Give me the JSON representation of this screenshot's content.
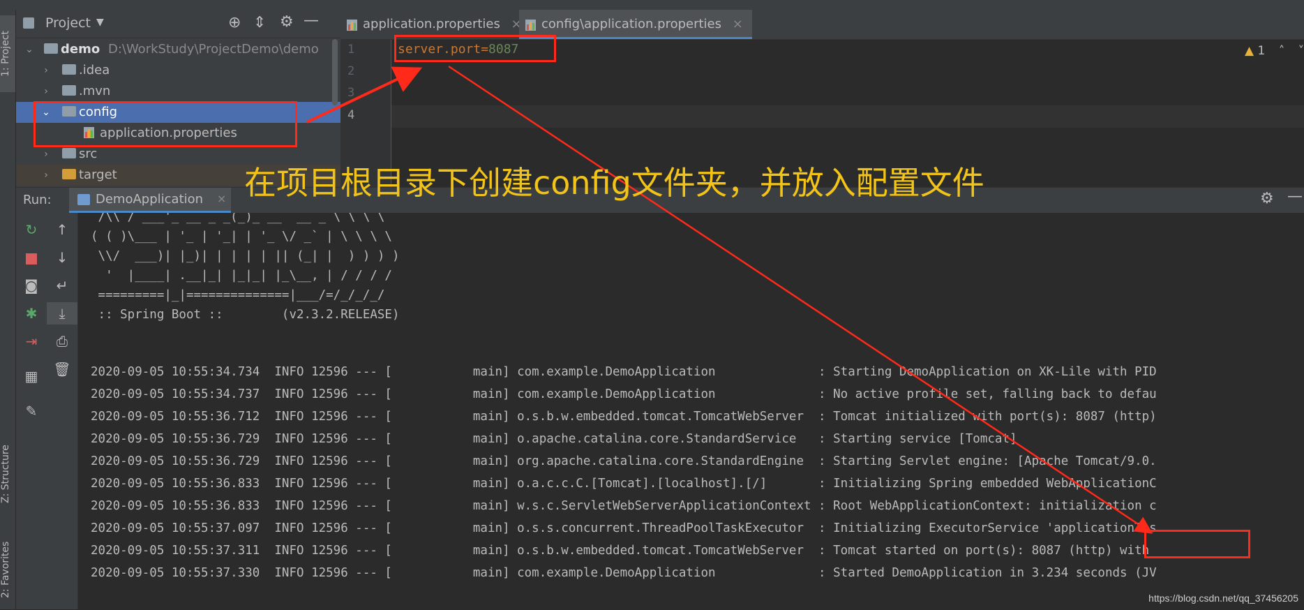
{
  "side_tabs": {
    "project": "1: Project",
    "structure": "Z: Structure",
    "favorites": "2: Favorites"
  },
  "project": {
    "title": "Project",
    "tree": [
      {
        "name": "demo",
        "path": "D:\\WorkStudy\\ProjectDemo\\demo"
      },
      {
        "name": ".idea"
      },
      {
        "name": ".mvn"
      },
      {
        "name": "config"
      },
      {
        "name": "application.properties"
      },
      {
        "name": "src"
      },
      {
        "name": "target"
      }
    ]
  },
  "editor": {
    "tabs": [
      {
        "label": "application.properties"
      },
      {
        "label": "config\\application.properties"
      }
    ],
    "line_numbers": [
      "1",
      "2",
      "3",
      "4"
    ],
    "code_key": "server.port=",
    "code_value": "8087",
    "warning_count": "1"
  },
  "run": {
    "label": "Run:",
    "tab": "DemoApplication"
  },
  "console": {
    "banner": [
      " /\\\\ / ___'_ __ _ _(_)_ __  __ _ \\ \\ \\ \\",
      "( ( )\\___ | '_ | '_| | '_ \\/ _` | \\ \\ \\ \\",
      " \\\\/  ___)| |_)| | | | | || (_| |  ) ) ) )",
      "  '  |____| .__|_| |_|_| |_\\__, | / / / /",
      " =========|_|==============|___/=/_/_/_/",
      " :: Spring Boot ::        (v2.3.2.RELEASE)"
    ],
    "logs": [
      "2020-09-05 10:55:34.734  INFO 12596 --- [           main] com.example.DemoApplication              : Starting DemoApplication on XK-Lile with PID",
      "2020-09-05 10:55:34.737  INFO 12596 --- [           main] com.example.DemoApplication              : No active profile set, falling back to defau",
      "2020-09-05 10:55:36.712  INFO 12596 --- [           main] o.s.b.w.embedded.tomcat.TomcatWebServer  : Tomcat initialized with port(s): 8087 (http)",
      "2020-09-05 10:55:36.729  INFO 12596 --- [           main] o.apache.catalina.core.StandardService   : Starting service [Tomcat]",
      "2020-09-05 10:55:36.729  INFO 12596 --- [           main] org.apache.catalina.core.StandardEngine  : Starting Servlet engine: [Apache Tomcat/9.0.",
      "2020-09-05 10:55:36.833  INFO 12596 --- [           main] o.a.c.c.C.[Tomcat].[localhost].[/]       : Initializing Spring embedded WebApplicationC",
      "2020-09-05 10:55:36.833  INFO 12596 --- [           main] w.s.c.ServletWebServerApplicationContext : Root WebApplicationContext: initialization c",
      "2020-09-05 10:55:37.097  INFO 12596 --- [           main] o.s.s.concurrent.ThreadPoolTaskExecutor  : Initializing ExecutorService 'applicationTas",
      "2020-09-05 10:55:37.311  INFO 12596 --- [           main] o.s.b.w.embedded.tomcat.TomcatWebServer  : Tomcat started on port(s): 8087 (http) with",
      "2020-09-05 10:55:37.330  INFO 12596 --- [           main] com.example.DemoApplication              : Started DemoApplication in 3.234 seconds (JV"
    ]
  },
  "annotation": "在项目根目录下创建config文件夹，并放入配置文件",
  "watermark": "https://blog.csdn.net/qq_37456205",
  "colors": {
    "accent": "#4b6eaf",
    "annotation_box": "#ff2a1a",
    "annotation_text": "#f2c318",
    "code_value": "#6a8759"
  }
}
